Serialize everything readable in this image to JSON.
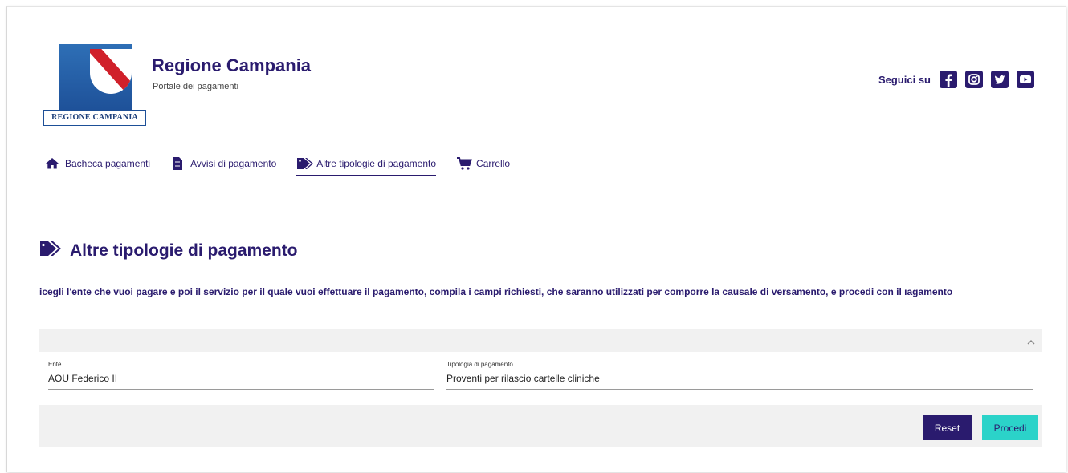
{
  "header": {
    "logo_caption": "REGIONE CAMPANIA",
    "title": "Regione Campania",
    "subtitle": "Portale dei pagamenti",
    "social_label": "Seguici su",
    "social_icons": [
      "facebook-icon",
      "instagram-icon",
      "twitter-icon",
      "youtube-icon"
    ]
  },
  "nav": {
    "items": [
      {
        "label": "Bacheca pagamenti",
        "icon": "home-icon",
        "active": false
      },
      {
        "label": "Avvisi di pagamento",
        "icon": "document-icon",
        "active": false
      },
      {
        "label": "Altre tipologie di pagamento",
        "icon": "tags-icon",
        "active": true
      },
      {
        "label": "Carrello",
        "icon": "cart-icon",
        "active": false
      }
    ]
  },
  "main": {
    "title": "Altre tipologie di pagamento",
    "intro": "icegli l'ente che vuoi pagare e poi il servizio per il quale vuoi effettuare il pagamento, compila i campi richiesti, che saranno utilizzati per comporre la causale di versamento, e procedi con il ıagamento",
    "form": {
      "ente_label": "Ente",
      "ente_value": "AOU Federico II",
      "tipologia_label": "Tipologia di pagamento",
      "tipologia_value": "Proventi per rilascio cartelle cliniche",
      "reset_label": "Reset",
      "procedi_label": "Procedi"
    }
  },
  "colors": {
    "primary": "#2a1b6e",
    "accent": "#2bd3c9",
    "panel": "#f1f1f1"
  }
}
